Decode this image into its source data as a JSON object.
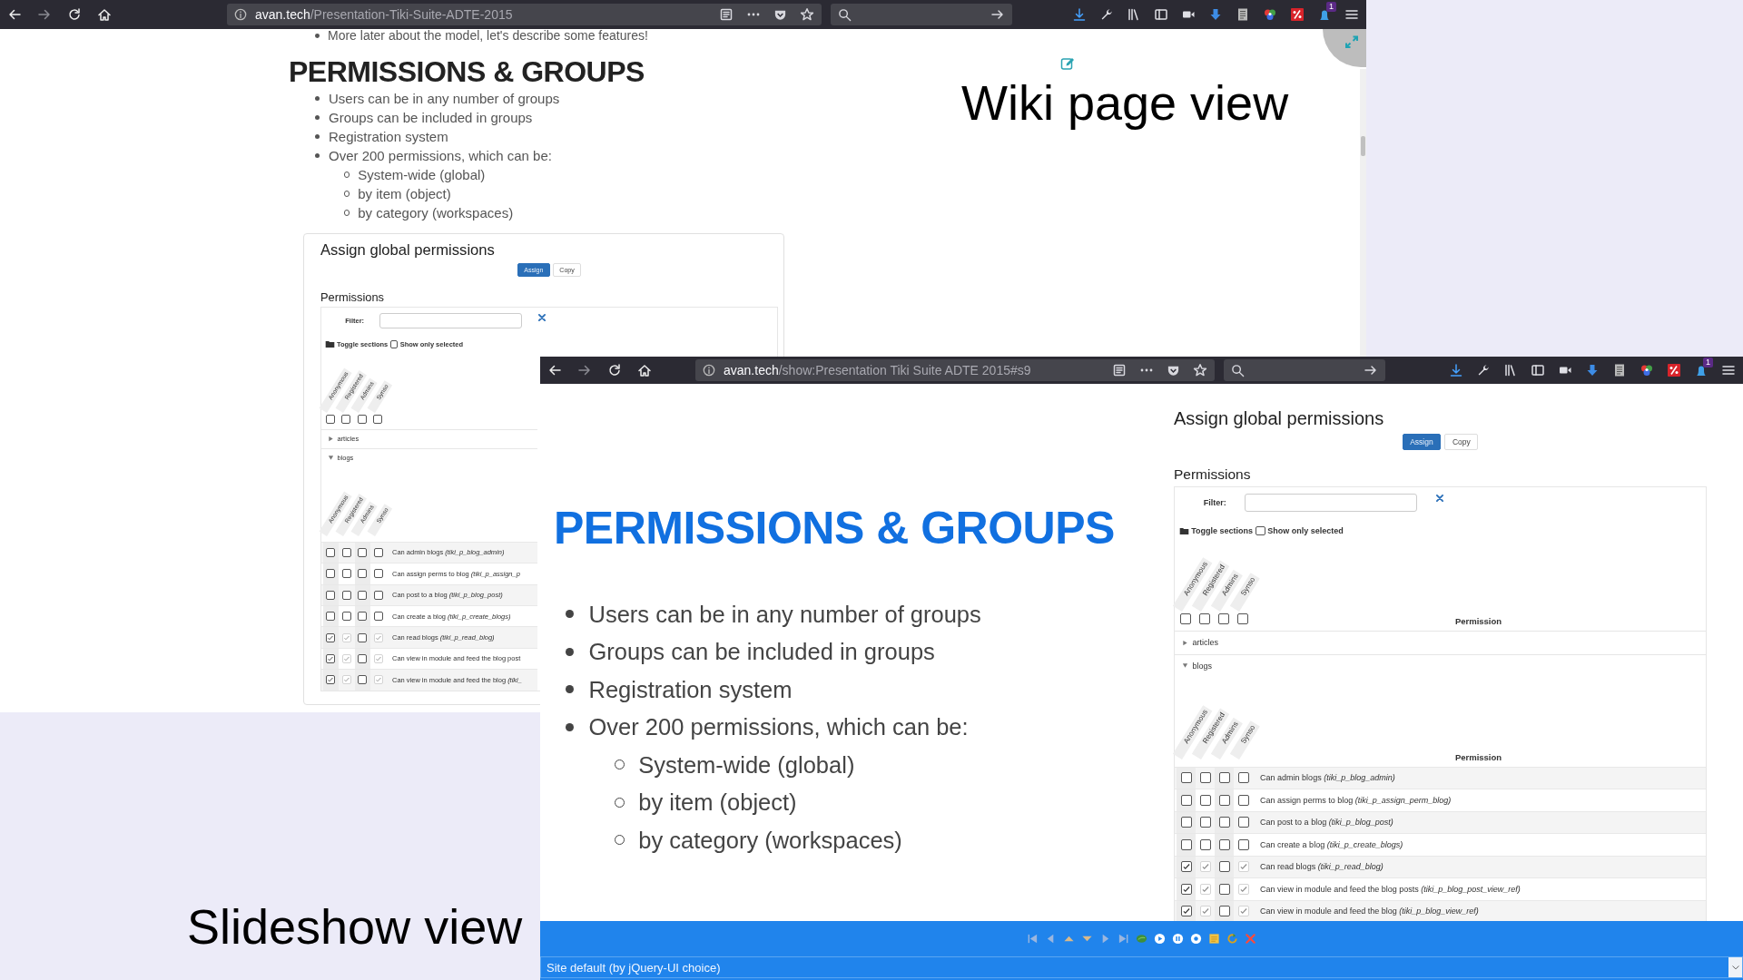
{
  "wiki_window": {
    "toolbar": {
      "url_host": "avan.tech",
      "url_path": "/Presentation-Tiki-Suite-ADTE-2015",
      "notification_count": "1"
    },
    "intro_bullets": [
      "More later about the model, let's describe some features!"
    ],
    "heading": "PERMISSIONS & GROUPS",
    "bullets": [
      {
        "text": "Users can be in any number of groups"
      },
      {
        "text": "Groups can be included in groups"
      },
      {
        "text": "Registration system"
      },
      {
        "text": "Over 200 permissions, which can be:",
        "children": [
          {
            "text": "System-wide (global)"
          },
          {
            "text": "by item (object)"
          },
          {
            "text": "by category (workspaces)"
          }
        ]
      }
    ],
    "panel": {
      "title": "Assign global permissions",
      "buttons": [
        {
          "label": "Assign",
          "primary": true
        },
        {
          "label": "Copy",
          "primary": false
        }
      ],
      "section_title": "Permissions",
      "filter_label": "Filter:",
      "toggle_label": "Toggle sections",
      "show_only": {
        "label": "Show only selected",
        "checked": false
      },
      "groups": [
        {
          "label": "Anonymous",
          "checked": false
        },
        {
          "label": "Registered",
          "checked": false
        },
        {
          "label": "Admins",
          "checked": false
        },
        {
          "label": "Synso",
          "checked": false
        }
      ],
      "sections": [
        {
          "name": "articles",
          "expanded": false
        },
        {
          "name": "blogs",
          "expanded": true,
          "groups": [
            "Anonymous",
            "Registered",
            "Admins",
            "Synso"
          ],
          "rows": [
            {
              "label": "Can admin blogs *(tiki_p_blog_admin)*",
              "checks": [
                {
                  "checked": false,
                  "disabled": false
                },
                {
                  "checked": false,
                  "disabled": false
                },
                {
                  "checked": false,
                  "disabled": false
                },
                {
                  "checked": false,
                  "disabled": false
                }
              ]
            },
            {
              "label": "Can assign perms to blog *(tiki_p_assign_p*",
              "checks": [
                {
                  "checked": false,
                  "disabled": false
                },
                {
                  "checked": false,
                  "disabled": false
                },
                {
                  "checked": false,
                  "disabled": false
                },
                {
                  "checked": false,
                  "disabled": false
                }
              ]
            },
            {
              "label": "Can post to a blog *(tiki_p_blog_post)*",
              "checks": [
                {
                  "checked": false,
                  "disabled": false
                },
                {
                  "checked": false,
                  "disabled": false
                },
                {
                  "checked": false,
                  "disabled": false
                },
                {
                  "checked": false,
                  "disabled": false
                }
              ]
            },
            {
              "label": "Can create a blog *(tiki_p_create_blogs)*",
              "checks": [
                {
                  "checked": false,
                  "disabled": false
                },
                {
                  "checked": false,
                  "disabled": false
                },
                {
                  "checked": false,
                  "disabled": false
                },
                {
                  "checked": false,
                  "disabled": false
                }
              ]
            },
            {
              "label": "Can read blogs *(tiki_p_read_blog)*",
              "checks": [
                {
                  "checked": true,
                  "disabled": false
                },
                {
                  "checked": true,
                  "disabled": true
                },
                {
                  "checked": false,
                  "disabled": false
                },
                {
                  "checked": true,
                  "disabled": true
                }
              ]
            },
            {
              "label": "Can view in module and feed the blog post",
              "checks": [
                {
                  "checked": true,
                  "disabled": false
                },
                {
                  "checked": true,
                  "disabled": true
                },
                {
                  "checked": false,
                  "disabled": false
                },
                {
                  "checked": true,
                  "disabled": true
                }
              ]
            },
            {
              "label": "Can view in module and feed the blog *(tiki_*",
              "checks": [
                {
                  "checked": true,
                  "disabled": false
                },
                {
                  "checked": true,
                  "disabled": true
                },
                {
                  "checked": false,
                  "disabled": false
                },
                {
                  "checked": true,
                  "disabled": true
                }
              ]
            }
          ]
        }
      ]
    }
  },
  "wiki_caption": "Wiki page view",
  "slideshow_window": {
    "toolbar": {
      "url_host": "avan.tech",
      "url_path": "/show:Presentation Tiki Suite ADTE 2015#s9",
      "notification_count": "1"
    },
    "heading": "PERMISSIONS & GROUPS",
    "bullets": [
      {
        "text": "Users can be in any number of groups"
      },
      {
        "text": "Groups can be included in groups"
      },
      {
        "text": "Registration system"
      },
      {
        "text": "Over 200 permissions, which can be:",
        "children": [
          {
            "text": "System-wide (global)"
          },
          {
            "text": "by item (object)"
          },
          {
            "text": "by category (workspaces)"
          }
        ]
      }
    ],
    "panel": {
      "title": "Assign global permissions",
      "buttons": [
        {
          "label": "Assign",
          "primary": true
        },
        {
          "label": "Copy",
          "primary": false
        }
      ],
      "section_title": "Permissions",
      "filter_label": "Filter:",
      "toggle_label": "Toggle sections",
      "show_only": {
        "label": "Show only selected",
        "checked": false
      },
      "groups": [
        {
          "label": "Anonymous",
          "checked": false
        },
        {
          "label": "Registered",
          "checked": false
        },
        {
          "label": "Admins",
          "checked": false
        },
        {
          "label": "Synso",
          "checked": false
        }
      ],
      "permission_header": "Permission",
      "sections": [
        {
          "name": "articles",
          "expanded": false
        },
        {
          "name": "blogs",
          "expanded": true,
          "groups": [
            "Anonymous",
            "Registered",
            "Admins",
            "Synso"
          ],
          "permission_header": "Permission",
          "rows": [
            {
              "label": "Can admin blogs *(tiki_p_blog_admin)*",
              "checks": [
                {
                  "checked": false,
                  "disabled": false
                },
                {
                  "checked": false,
                  "disabled": false
                },
                {
                  "checked": false,
                  "disabled": false
                },
                {
                  "checked": false,
                  "disabled": false
                }
              ]
            },
            {
              "label": "Can assign perms to blog *(tiki_p_assign_perm_blog)*",
              "checks": [
                {
                  "checked": false,
                  "disabled": false
                },
                {
                  "checked": false,
                  "disabled": false
                },
                {
                  "checked": false,
                  "disabled": false
                },
                {
                  "checked": false,
                  "disabled": false
                }
              ]
            },
            {
              "label": "Can post to a blog *(tiki_p_blog_post)*",
              "checks": [
                {
                  "checked": false,
                  "disabled": false
                },
                {
                  "checked": false,
                  "disabled": false
                },
                {
                  "checked": false,
                  "disabled": false
                },
                {
                  "checked": false,
                  "disabled": false
                }
              ]
            },
            {
              "label": "Can create a blog *(tiki_p_create_blogs)*",
              "checks": [
                {
                  "checked": false,
                  "disabled": false
                },
                {
                  "checked": false,
                  "disabled": false
                },
                {
                  "checked": false,
                  "disabled": false
                },
                {
                  "checked": false,
                  "disabled": false
                }
              ]
            },
            {
              "label": "Can read blogs *(tiki_p_read_blog)*",
              "checks": [
                {
                  "checked": true,
                  "disabled": false
                },
                {
                  "checked": true,
                  "disabled": true
                },
                {
                  "checked": false,
                  "disabled": false
                },
                {
                  "checked": true,
                  "disabled": true
                }
              ]
            },
            {
              "label": "Can view in module and feed the blog posts *(tiki_p_blog_post_view_ref)*",
              "checks": [
                {
                  "checked": true,
                  "disabled": false
                },
                {
                  "checked": true,
                  "disabled": true
                },
                {
                  "checked": false,
                  "disabled": false
                },
                {
                  "checked": true,
                  "disabled": true
                }
              ]
            },
            {
              "label": "Can view in module and feed the blog *(tiki_p_blog_view_ref)*",
              "checks": [
                {
                  "checked": true,
                  "disabled": false
                },
                {
                  "checked": true,
                  "disabled": true
                },
                {
                  "checked": false,
                  "disabled": false
                },
                {
                  "checked": true,
                  "disabled": true
                }
              ]
            }
          ]
        }
      ]
    },
    "footer": {
      "theme": "Site default (by jQuery-UI choice)"
    }
  },
  "slideshow_caption": "Slideshow view"
}
